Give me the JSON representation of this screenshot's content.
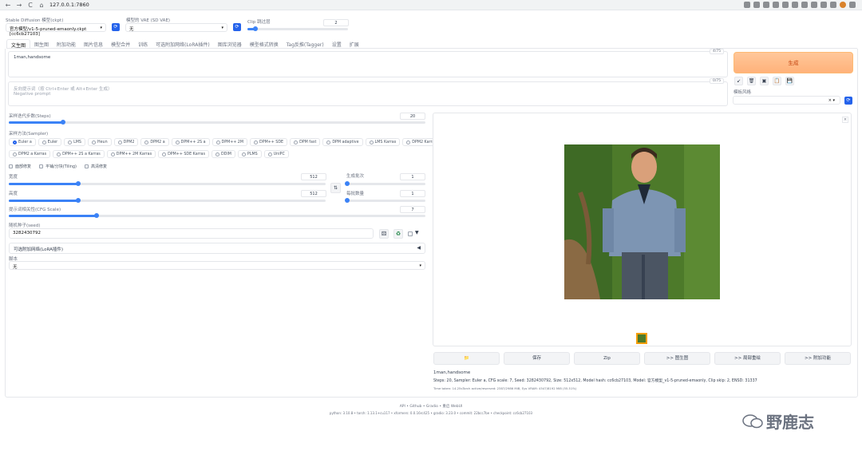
{
  "browser": {
    "url": "127.0.0.1:7860"
  },
  "header": {
    "model_label": "Stable Diffusion 模型(ckpt)",
    "model_value": "官方模型/v1-5-pruned-emaonly.ckpt [cc6cb27103]",
    "vae_label": "模型的 VAE (SD VAE)",
    "vae_value": "无",
    "clip_label": "Clip 跳过层",
    "clip_value": "2",
    "clip_fraction": 0.083
  },
  "tabs": [
    "文生图",
    "图生图",
    "附加功能",
    "图片信息",
    "模型合并",
    "训练",
    "可选附加网络(LoRA插件)",
    "图库浏览器",
    "模型格式转换",
    "Tag反推(Tagger)",
    "设置",
    "扩展"
  ],
  "prompt": {
    "value": "1man,handsome",
    "count": "4/75"
  },
  "negative": {
    "placeholder_title": "反向提示词（按 Ctrl+Enter 或 Alt+Enter 生成）",
    "placeholder_sub": "Negative prompt",
    "count": "0/75"
  },
  "generate_label": "生成",
  "tools": [
    "↙",
    "🗑",
    "▣",
    "📋",
    "💾"
  ],
  "style_label": "模板风格",
  "style_close": "× ▾",
  "steps": {
    "label": "采样迭代步数(Steps)",
    "value": "20",
    "fraction": 0.13
  },
  "sampler": {
    "label": "采样方法(Sampler)",
    "row1": [
      "Euler a",
      "Euler",
      "LMS",
      "Heun",
      "DPM2",
      "DPM2 a",
      "DPM++ 2S a",
      "DPM++ 2M",
      "DPM++ SDE",
      "DPM fast",
      "DPM adaptive",
      "LMS Karras",
      "DPM2 Karras"
    ],
    "row2": [
      "DPM2 a Karras",
      "DPM++ 2S a Karras",
      "DPM++ 2M Karras",
      "DPM++ SDE Karras",
      "DDIM",
      "PLMS",
      "UniPC"
    ],
    "selected": "Euler a"
  },
  "options": [
    "面部修复",
    "平铺/分块(Tiling)",
    "高清修复"
  ],
  "width": {
    "label": "宽度",
    "value": "512",
    "fraction": 0.22
  },
  "height": {
    "label": "高度",
    "value": "512",
    "fraction": 0.22
  },
  "batch_count": {
    "label": "生成批次",
    "value": "1",
    "fraction": 0.0
  },
  "batch_size": {
    "label": "每批数量",
    "value": "1",
    "fraction": 0.0
  },
  "swap_icon": "⇅",
  "cfg": {
    "label": "提示词相关性(CFG Scale)",
    "value": "7",
    "fraction": 0.21
  },
  "seed": {
    "label": "随机种子(seed)",
    "value": "3282430792",
    "dice": "⚄",
    "recycle": "♻",
    "extra": "▼"
  },
  "lora_accordion": {
    "label": "可选附加网络(LoRA插件)",
    "arrow": "◀"
  },
  "script": {
    "label": "脚本",
    "value": "无"
  },
  "output": {
    "buttons": [
      "📁",
      "保存",
      "Zip",
      ">> 图生图",
      ">> 局部重绘",
      ">> 附加功能"
    ],
    "info_prompt": "1man,handsome",
    "info_params": "Steps: 20, Sampler: Euler a, CFG scale: 7, Seed: 3282430792, Size: 512x512, Model hash: cc6cb27103, Model: 官方模型_v1-5-pruned-emaonly, Clip skip: 2, ENSD: 31337",
    "info_time": "Time taken: 14.25sTorch active/reserved: 2387/2986 MiB, Sys VRAM: 4547/8192 MiB (55.51%)",
    "close": "×"
  },
  "footer": {
    "links": "API  •  Github  •  Gradio  •  重启 WebUI",
    "versions": "python: 3.10.8  •  torch: 1.13.1+cu117  •  xformers: 0.0.16rc425  •  gradio: 3.23.0  •  commit: 22bcc7be  •  checkpoint: cc6cb27103"
  },
  "watermark": "野鹿志"
}
